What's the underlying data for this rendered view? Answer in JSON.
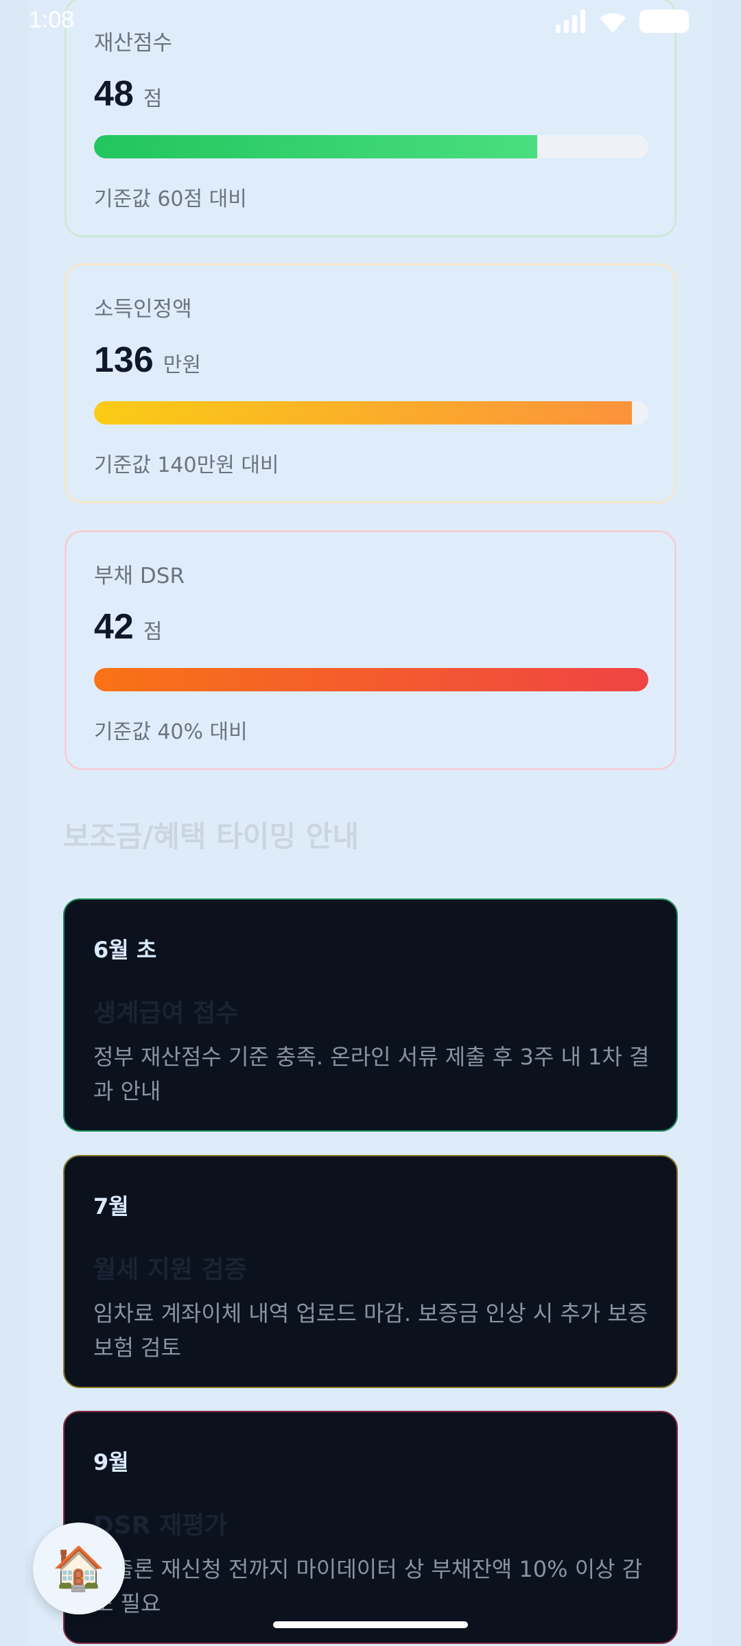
{
  "status_bar": {
    "time": "1:08"
  },
  "metrics": [
    {
      "label": "재산점수",
      "value": "48",
      "unit": "점",
      "note": "기준값 60점 대비",
      "progress": 0.8,
      "border": "#cde8d7",
      "fill_from": "#22c55e",
      "fill_to": "#4ade80"
    },
    {
      "label": "소득인정액",
      "value": "136",
      "unit": "만원",
      "note": "기준값 140만원 대비",
      "progress": 0.97,
      "border": "#f5e7c8",
      "fill_from": "#facc15",
      "fill_to": "#fb923c"
    },
    {
      "label": "부채 DSR",
      "value": "42",
      "unit": "점",
      "note": "기준값 40% 대비",
      "progress": 1.0,
      "border": "#f4cfd6",
      "fill_from": "#f97316",
      "fill_to": "#ef4444"
    }
  ],
  "timing_section": {
    "title": "보조금/혜택 타이밍 안내",
    "items": [
      {
        "when": "6월 초",
        "title": "생계급여 접수",
        "desc": "정부 재산점수 기준 충족. 온라인 서류 제출 후 3주 내 1차 결과 안내",
        "border": "#1f8a5b"
      },
      {
        "when": "7월",
        "title": "월세 지원 검증",
        "desc": "임차료 계좌이체 내역 업로드 마감. 보증금 인상 시 추가 보증보험 검토",
        "border": "#8a7a2a"
      },
      {
        "when": "9월",
        "title": "DSR 재평가",
        "desc": "대출론 재신청 전까지 마이데이터 상 부채잔액 10% 이상 감소 필요",
        "border": "#8a2e45"
      }
    ]
  },
  "fab": {
    "icon": "house-icon"
  }
}
